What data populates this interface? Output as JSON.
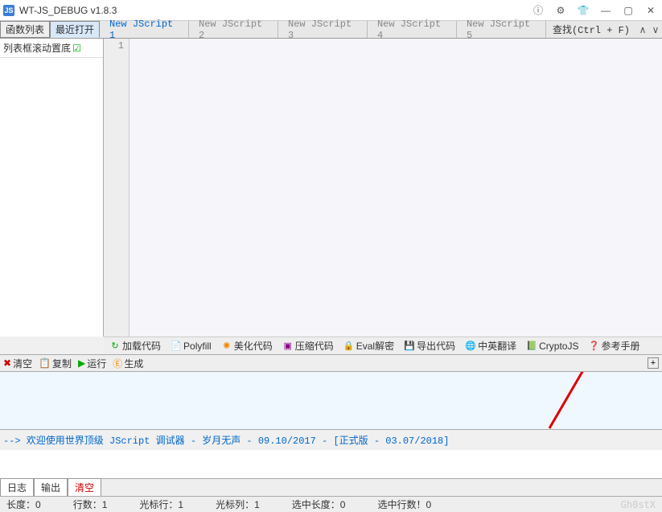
{
  "title": "WT-JS_DEBUG v1.8.3",
  "logo_text": "JS",
  "sidetabs": {
    "funcs": "函数列表",
    "recent": "最近打开"
  },
  "filetabs": [
    {
      "label": "New JScript 1",
      "active": true
    },
    {
      "label": "New JScript 2",
      "active": false
    },
    {
      "label": "New JScript 3",
      "active": false
    },
    {
      "label": "New JScript 4",
      "active": false
    },
    {
      "label": "New JScript 5",
      "active": false
    }
  ],
  "search_label": "查找(Ctrl + F)",
  "sidebar_header": "列表框滚动置底",
  "gutter_line": "1",
  "toolbar": {
    "load": "加载代码",
    "polyfill": "Polyfill",
    "beautify": "美化代码",
    "compress": "压缩代码",
    "eval": "Eval解密",
    "export": "导出代码",
    "translate": "中英翻译",
    "cryptojs": "CryptoJS",
    "manual": "参考手册"
  },
  "actionbar": {
    "clear": "清空",
    "copy": "复制",
    "run": "运行",
    "gen": "生成"
  },
  "welcome": "--> 欢迎使用世界顶级 JScript 调试器 - 岁月无声 - 09.10/2017 - [正式版 - 03.07/2018]",
  "bottomtabs": {
    "log": "日志",
    "output": "输出",
    "clear": "清空"
  },
  "status": {
    "length": "长度：0",
    "lines": "行数：1",
    "cursor_line": "光标行：1",
    "cursor_col": "光标列：1",
    "sel_len": "选中长度：0",
    "sel_lines": "选中行数！0"
  },
  "watermark": "Gh0stX"
}
